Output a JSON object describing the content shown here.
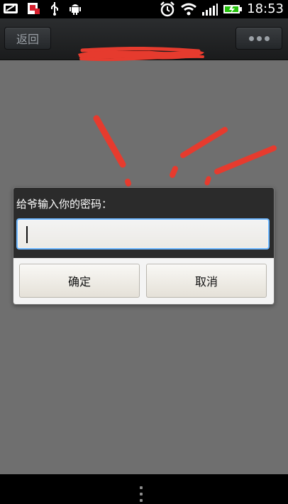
{
  "status": {
    "time": "18:53",
    "icons": [
      "battery-saver-icon",
      "notification-icon",
      "usb-icon",
      "android-icon",
      "alarm-icon",
      "wifi-icon",
      "signal-icon",
      "battery-icon"
    ]
  },
  "titlebar": {
    "back_label": "返回",
    "more_icon": "more-icon"
  },
  "dialog": {
    "title": "给爷输入你的密码：",
    "input_value": "",
    "input_placeholder": "",
    "confirm_label": "确定",
    "cancel_label": "取消"
  },
  "colors": {
    "background": "#6f6f6f",
    "statusbar": "#000000",
    "titlebar": "#222426",
    "dialog": "#2b2b2b",
    "input_border": "#6db7ff",
    "button_face": "#f1efea",
    "red_scribble": "#e63b2e"
  }
}
